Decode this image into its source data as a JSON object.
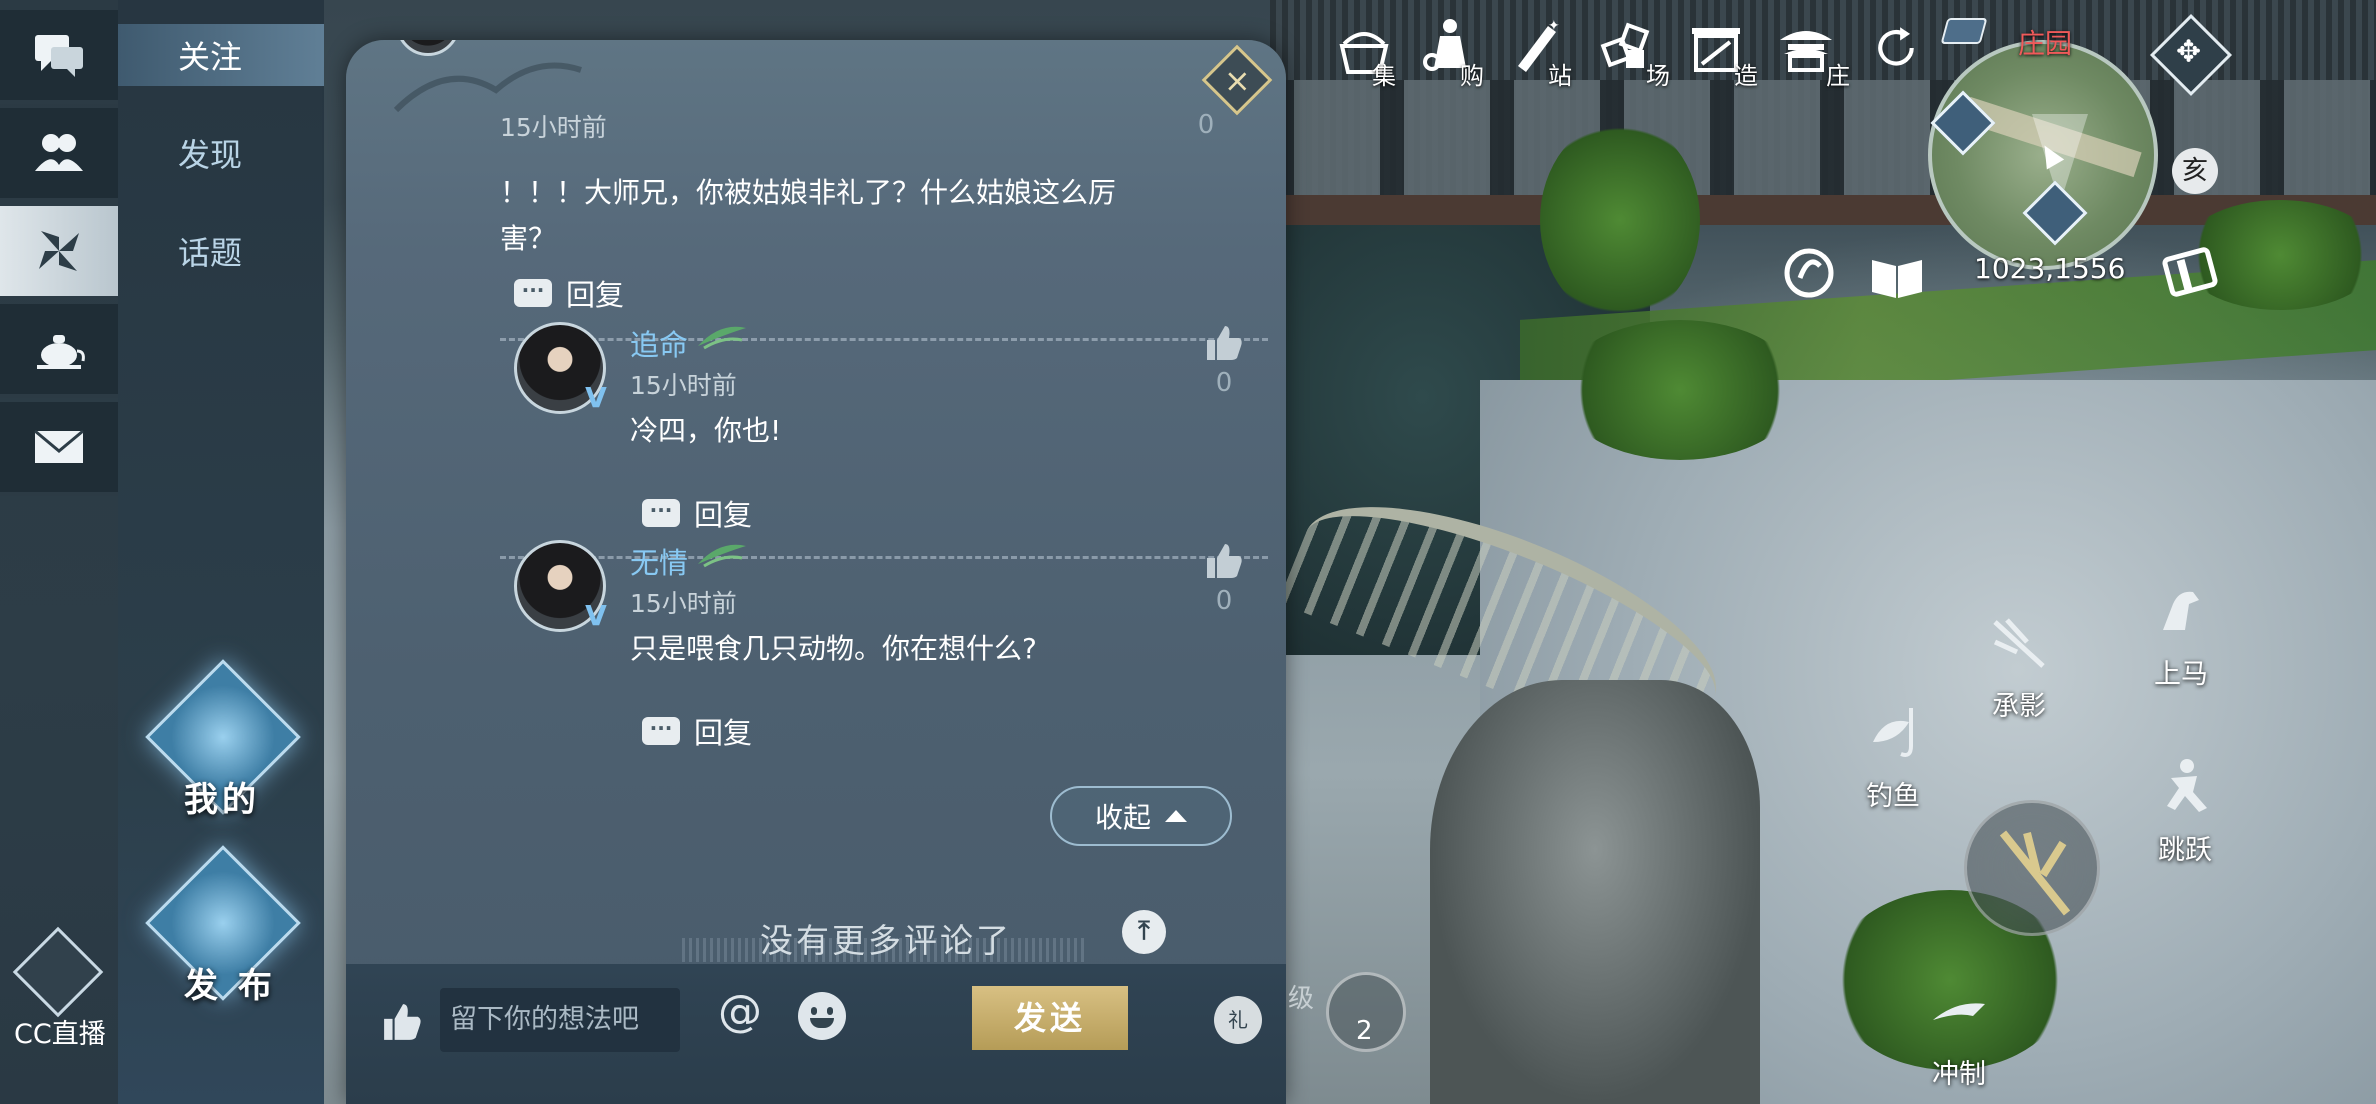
{
  "rail": {
    "items": [
      {
        "icon": "chat-bubbles-icon",
        "active": false
      },
      {
        "icon": "friends-icon",
        "active": false
      },
      {
        "icon": "pinwheel-icon",
        "active": true
      },
      {
        "icon": "teapot-icon",
        "active": false
      },
      {
        "icon": "mail-icon",
        "active": false
      }
    ],
    "cc_label": "CC直播"
  },
  "subnav": {
    "items": [
      {
        "label": "关注",
        "active": true
      },
      {
        "label": "发现",
        "active": false
      },
      {
        "label": "话题",
        "active": false
      }
    ],
    "my_label": "我的",
    "publish_label": "发 布"
  },
  "comments": {
    "partial_top": {
      "time": "15小时前",
      "likes": "0",
      "text": "！！！大师兄，你被姑娘非礼了？什么姑娘这么厉害？",
      "reply_label": "回复"
    },
    "replies": [
      {
        "name": "追命",
        "time": "15小时前",
        "text": "冷四，你也!",
        "likes": "0",
        "reply_label": "回复"
      },
      {
        "name": "无情",
        "time": "15小时前",
        "text": "只是喂食几只动物。你在想什么?",
        "likes": "0",
        "reply_label": "回复"
      }
    ],
    "collapse_label": "收起",
    "no_more_label": "没有更多评论了"
  },
  "input_bar": {
    "placeholder": "留下你的想法吧",
    "at_symbol": "@",
    "send_label": "发送",
    "gift_label": "礼"
  },
  "hud": {
    "top_icons": [
      {
        "icon": "gather-basket-icon",
        "label": "集"
      },
      {
        "icon": "shop-icon",
        "label": "购"
      },
      {
        "icon": "brush-icon",
        "label": "站"
      },
      {
        "icon": "cubes-icon",
        "label": "场"
      },
      {
        "icon": "build-icon",
        "label": "造"
      },
      {
        "icon": "manor-icon",
        "label": "庄"
      }
    ],
    "map_title": "庄园",
    "coords": "1023,1556",
    "time_badge": "亥",
    "actions": [
      {
        "icon": "horse-icon",
        "label": "上马"
      },
      {
        "icon": "shadow-icon",
        "label": "承影"
      },
      {
        "icon": "fishing-icon",
        "label": "钓鱼"
      },
      {
        "icon": "jump-icon",
        "label": "跳跃"
      },
      {
        "icon": "dash-icon",
        "label": "冲制"
      }
    ],
    "level_label": "级",
    "skill_count": "2"
  },
  "colors": {
    "accent_name": "#88c9f3",
    "send_gold": "#c9b06c",
    "map_title_red": "#f05a5a"
  }
}
